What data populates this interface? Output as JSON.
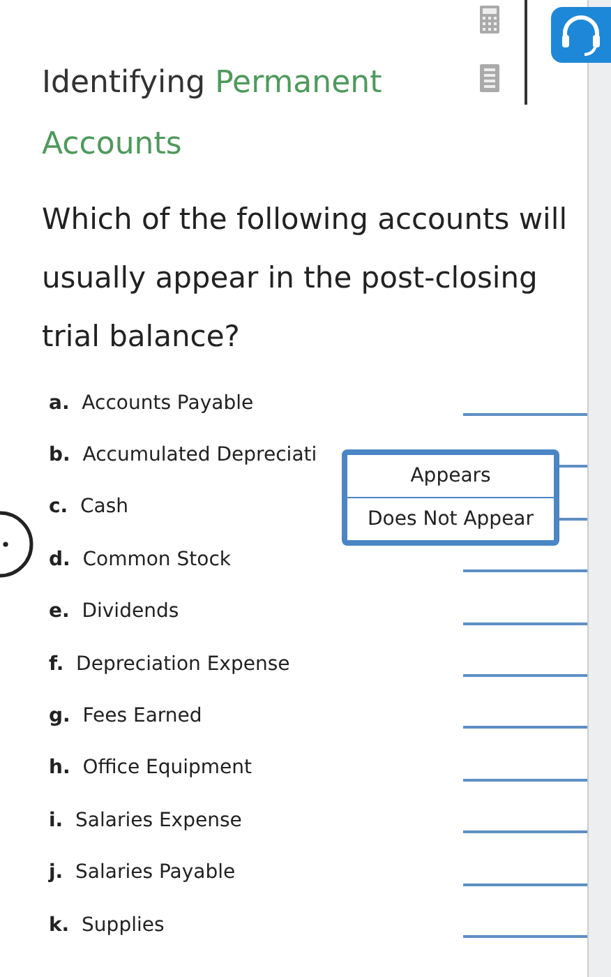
{
  "title_prefix": "Identifying",
  "title_highlight": "Permanent Accounts",
  "question": "Which of the following accounts will usually appear in the post-closing trial balance?",
  "items": [
    {
      "letter": "a.",
      "text": "Accounts Payable",
      "dropdown_open": false
    },
    {
      "letter": "b.",
      "text": "Accumulated Depreciati",
      "dropdown_open": true
    },
    {
      "letter": "c.",
      "text": "Cash",
      "dropdown_open": false
    },
    {
      "letter": "d.",
      "text": "Common Stock",
      "dropdown_open": false
    },
    {
      "letter": "e.",
      "text": "Dividends",
      "dropdown_open": false
    },
    {
      "letter": "f.",
      "text": "Depreciation Expense",
      "dropdown_open": false
    },
    {
      "letter": "g.",
      "text": "Fees Earned",
      "dropdown_open": false
    },
    {
      "letter": "h.",
      "text": "Office Equipment",
      "dropdown_open": false
    },
    {
      "letter": "i.",
      "text": "Salaries Expense",
      "dropdown_open": false
    },
    {
      "letter": "j.",
      "text": "Salaries Payable",
      "dropdown_open": false
    },
    {
      "letter": "k.",
      "text": "Supplies",
      "dropdown_open": false
    }
  ],
  "dropdown_options": [
    "Appears",
    "Does Not Appear"
  ]
}
